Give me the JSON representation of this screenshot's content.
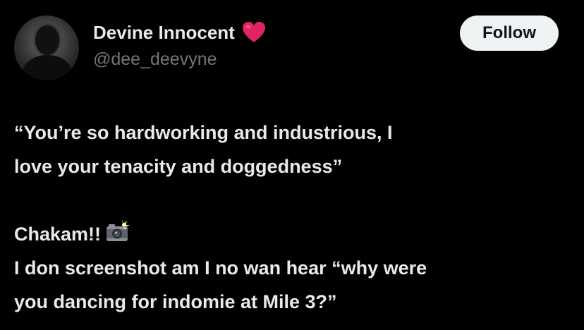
{
  "author": {
    "display_name": "Devine Innocent",
    "handle": "@dee_deevyne",
    "name_emoji": "red-heart-icon"
  },
  "actions": {
    "follow_label": "Follow"
  },
  "tweet": {
    "line1": "“You’re so hardworking and industrious, I",
    "line2": "love your tenacity and doggedness”",
    "line3": "Chakam!!",
    "line3_emoji": "camera-flash-icon",
    "line4": "I don screenshot am I no wan hear “why were",
    "line5": "you dancing for indomie at Mile 3?”"
  },
  "colors": {
    "background": "#000000",
    "text_primary": "#e7e9ea",
    "text_secondary": "#71767b",
    "button_bg": "#eff3f4",
    "button_text": "#0f1419",
    "heart": "#e0245e"
  }
}
